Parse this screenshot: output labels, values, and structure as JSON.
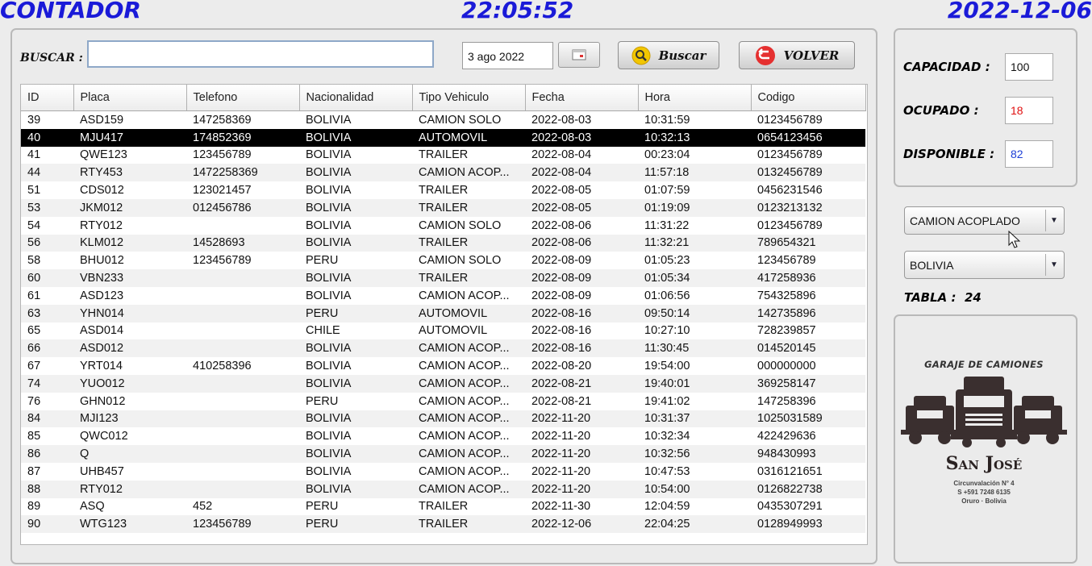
{
  "header": {
    "title": "CONTADOR",
    "time": "22:05:52",
    "date": "2022-12-06"
  },
  "search": {
    "label": "BUSCAR :",
    "value": "",
    "date_value": "3 ago 2022",
    "buscar_label": "Buscar",
    "volver_label": "VOLVER"
  },
  "table": {
    "columns": [
      "ID",
      "Placa",
      "Telefono",
      "Nacionalidad",
      "Tipo Vehiculo",
      "Fecha",
      "Hora",
      "Codigo"
    ],
    "selected_id": "40",
    "rows": [
      [
        "39",
        "ASD159",
        "147258369",
        "BOLIVIA",
        "CAMION SOLO",
        "2022-08-03",
        "10:31:59",
        "0123456789"
      ],
      [
        "40",
        "MJU417",
        "174852369",
        "BOLIVIA",
        "AUTOMOVIL",
        "2022-08-03",
        "10:32:13",
        "0654123456"
      ],
      [
        "41",
        "QWE123",
        "123456789",
        "BOLIVIA",
        "TRAILER",
        "2022-08-04",
        "00:23:04",
        "0123456789"
      ],
      [
        "44",
        "RTY453",
        "1472258369",
        "BOLIVIA",
        "CAMION ACOP...",
        "2022-08-04",
        "11:57:18",
        "0132456789"
      ],
      [
        "51",
        "CDS012",
        "123021457",
        "BOLIVIA",
        "TRAILER",
        "2022-08-05",
        "01:07:59",
        "0456231546"
      ],
      [
        "53",
        "JKM012",
        "012456786",
        "BOLIVIA",
        "TRAILER",
        "2022-08-05",
        "01:19:09",
        "0123213132"
      ],
      [
        "54",
        "RTY012",
        "",
        "BOLIVIA",
        "CAMION SOLO",
        "2022-08-06",
        "11:31:22",
        "0123456789"
      ],
      [
        "56",
        "KLM012",
        "14528693",
        "BOLIVIA",
        "TRAILER",
        "2022-08-06",
        "11:32:21",
        "789654321"
      ],
      [
        "58",
        "BHU012",
        "123456789",
        "PERU",
        "CAMION SOLO",
        "2022-08-09",
        "01:05:23",
        "123456789"
      ],
      [
        "60",
        "VBN233",
        "",
        "BOLIVIA",
        "TRAILER",
        "2022-08-09",
        "01:05:34",
        "417258936"
      ],
      [
        "61",
        "ASD123",
        "",
        "BOLIVIA",
        "CAMION ACOP...",
        "2022-08-09",
        "01:06:56",
        "754325896"
      ],
      [
        "63",
        "YHN014",
        "",
        "PERU",
        "AUTOMOVIL",
        "2022-08-16",
        "09:50:14",
        "142735896"
      ],
      [
        "65",
        "ASD014",
        "",
        "CHILE",
        "AUTOMOVIL",
        "2022-08-16",
        "10:27:10",
        "728239857"
      ],
      [
        "66",
        "ASD012",
        "",
        "BOLIVIA",
        "CAMION ACOP...",
        "2022-08-16",
        "11:30:45",
        "014520145"
      ],
      [
        "67",
        "YRT014",
        "410258396",
        "BOLIVIA",
        "CAMION ACOP...",
        "2022-08-20",
        "19:54:00",
        "000000000"
      ],
      [
        "74",
        "YUO012",
        "",
        "BOLIVIA",
        "CAMION ACOP...",
        "2022-08-21",
        "19:40:01",
        "369258147"
      ],
      [
        "76",
        "GHN012",
        "",
        "PERU",
        "CAMION ACOP...",
        "2022-08-21",
        "19:41:02",
        "147258396"
      ],
      [
        "84",
        "MJI123",
        "",
        "BOLIVIA",
        "CAMION ACOP...",
        "2022-11-20",
        "10:31:37",
        "1025031589"
      ],
      [
        "85",
        "QWC012",
        "",
        "BOLIVIA",
        "CAMION ACOP...",
        "2022-11-20",
        "10:32:34",
        "422429636"
      ],
      [
        "86",
        "Q",
        "",
        "BOLIVIA",
        "CAMION ACOP...",
        "2022-11-20",
        "10:32:56",
        "948430993"
      ],
      [
        "87",
        "UHB457",
        "",
        "BOLIVIA",
        "CAMION ACOP...",
        "2022-11-20",
        "10:47:53",
        "0316121651"
      ],
      [
        "88",
        "RTY012",
        "",
        "BOLIVIA",
        "CAMION ACOP...",
        "2022-11-20",
        "10:54:00",
        "0126822738"
      ],
      [
        "89",
        "ASQ",
        "452",
        "PERU",
        "TRAILER",
        "2022-11-30",
        "12:04:59",
        "0435307291"
      ],
      [
        "90",
        "WTG123",
        "123456789",
        "PERU",
        "TRAILER",
        "2022-12-06",
        "22:04:25",
        "0128949993"
      ]
    ]
  },
  "stats": {
    "capacidad_label": "CAPACIDAD :",
    "capacidad": "100",
    "ocupado_label": "OCUPADO :",
    "ocupado": "18",
    "disponible_label": "DISPONIBLE :",
    "disponible": "82"
  },
  "filters": {
    "vehicle_type": "CAMION ACOPLADO",
    "nationality": "BOLIVIA"
  },
  "tabla": {
    "label": "TABLA :",
    "count": "24"
  },
  "logo": {
    "top_text": "GARAJE DE CAMIONES",
    "name": "San José",
    "line1": "Circunvalación N° 4",
    "line2": "S +591 7248 6135",
    "line3": "Oruro · Bolivia"
  },
  "colors": {
    "header": "#1a1ad8",
    "selected_row": "#000000",
    "ocupado": "#e01010",
    "disponible": "#1d3fd6"
  },
  "icons": {
    "search_button": "magnifier-icon",
    "volver_button": "return-arrow-icon",
    "calendar": "calendar-icon"
  }
}
